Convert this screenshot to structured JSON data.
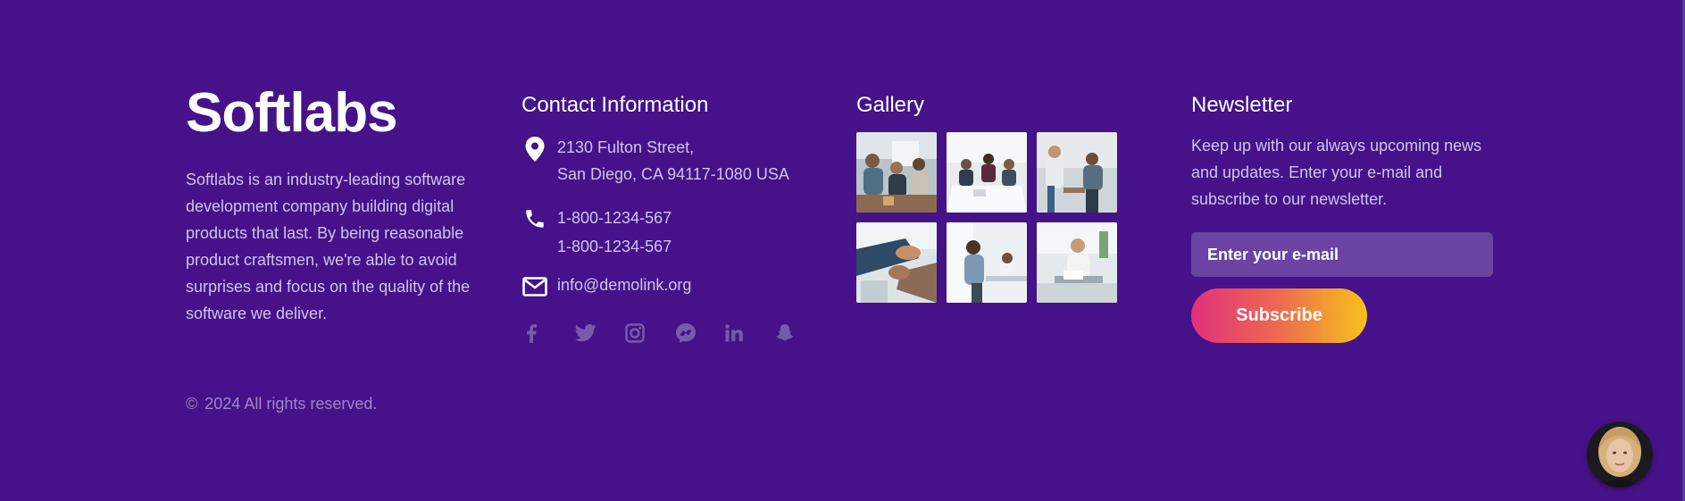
{
  "brand": {
    "logo_text": "Softlabs",
    "description": "Softlabs is an industry-leading software development company building digital products that last. By being reasonable product craftsmen, we're able to avoid surprises and focus on the quality of the software we deliver."
  },
  "contact": {
    "heading": "Contact Information",
    "address_line1": "2130 Fulton Street,",
    "address_line2": "San Diego, CA 94117-1080 USA",
    "phone1": "1-800-1234-567",
    "phone2": "1-800-1234-567",
    "email": "info@demolink.org",
    "icons": [
      "location-pin-icon",
      "phone-icon",
      "mail-icon"
    ],
    "socials": [
      "facebook-icon",
      "twitter-icon",
      "instagram-icon",
      "messenger-icon",
      "linkedin-icon",
      "snapchat-icon"
    ]
  },
  "gallery": {
    "heading": "Gallery",
    "images": [
      "team-meeting-photo",
      "office-table-photo",
      "coworkers-photo",
      "handshake-photo",
      "office-worker-photo",
      "reading-documents-photo"
    ]
  },
  "newsletter": {
    "heading": "Newsletter",
    "text": "Keep up with our always upcoming news and updates. Enter your e-mail and subscribe to our newsletter.",
    "email_placeholder": "Enter your e-mail",
    "email_value": "",
    "button_label": "Subscribe"
  },
  "footer": {
    "copyright_symbol": "©",
    "copyright_text": "2024 All rights reserved."
  },
  "colors": {
    "background": "#461289",
    "text_muted": "#d2c2ea",
    "input_bg": "#6a43a3",
    "gradient_start": "#e1307c",
    "gradient_end": "#f6c21b"
  }
}
